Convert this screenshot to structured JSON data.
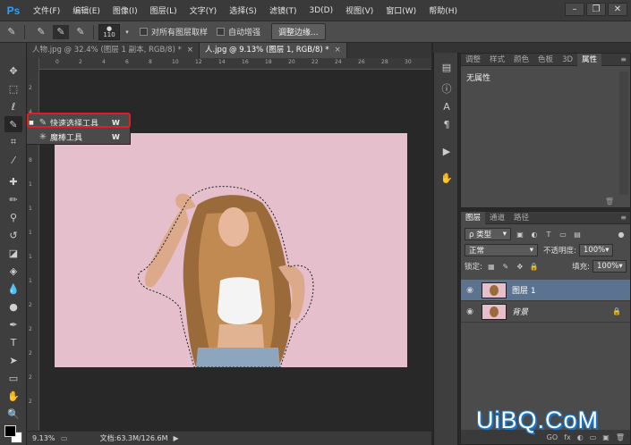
{
  "app": {
    "logo": "Ps"
  },
  "menu": [
    "文件(F)",
    "编辑(E)",
    "图像(I)",
    "图层(L)",
    "文字(Y)",
    "选择(S)",
    "滤镜(T)",
    "3D(D)",
    "视图(V)",
    "窗口(W)",
    "帮助(H)"
  ],
  "window_controls": {
    "minimize": "–",
    "restore": "❐",
    "close": "✕"
  },
  "options": {
    "brush_size": "110",
    "sample_all_layers": "对所有图层取样",
    "auto_enhance": "自动增强",
    "refine_edge": "调整边缘..."
  },
  "tabs": [
    {
      "label": "人物.jpg @ 32.4% (图层 1 副本, RGB/8) *",
      "close": "×"
    },
    {
      "label": "人.jpg @ 9.13% (图层 1, RGB/8) *",
      "close": "×"
    }
  ],
  "ruler_top_labels": [
    "0",
    "2",
    "4",
    "6",
    "8",
    "10",
    "12",
    "14",
    "16",
    "18",
    "20",
    "22",
    "24",
    "26",
    "28",
    "30"
  ],
  "ruler_left_labels": [
    "2",
    "4",
    "6",
    "8",
    "1",
    "1",
    "1",
    "1",
    "1",
    "2",
    "2",
    "2",
    "2",
    "2"
  ],
  "flyout": {
    "items": [
      {
        "bullet": "■",
        "label": "快速选择工具",
        "key": "W"
      },
      {
        "bullet": "",
        "label": "魔棒工具",
        "key": "W"
      }
    ]
  },
  "status": {
    "zoom": "9.13%",
    "doc": "文档:63.3M/126.6M",
    "arrow": "▶"
  },
  "properties_panel": {
    "tabs": [
      "调整",
      "样式",
      "颜色",
      "色板",
      "3D",
      "属性"
    ],
    "active_tab": "属性",
    "empty_text": "无属性"
  },
  "layers_panel": {
    "tabs": [
      "图层",
      "通道",
      "路径"
    ],
    "filter_label": "ρ 类型",
    "blend_mode": "正常",
    "opacity_label": "不透明度:",
    "opacity_value": "100%",
    "lock_label": "锁定:",
    "fill_label": "填充:",
    "fill_value": "100%",
    "layers": [
      {
        "name": "图层 1",
        "selected": true
      },
      {
        "name": "背景",
        "selected": false
      }
    ],
    "footer_icons": [
      "GO",
      "fx",
      "◐",
      "▭",
      "▣",
      "🗑"
    ]
  },
  "watermark": "UiBQ.CoM"
}
